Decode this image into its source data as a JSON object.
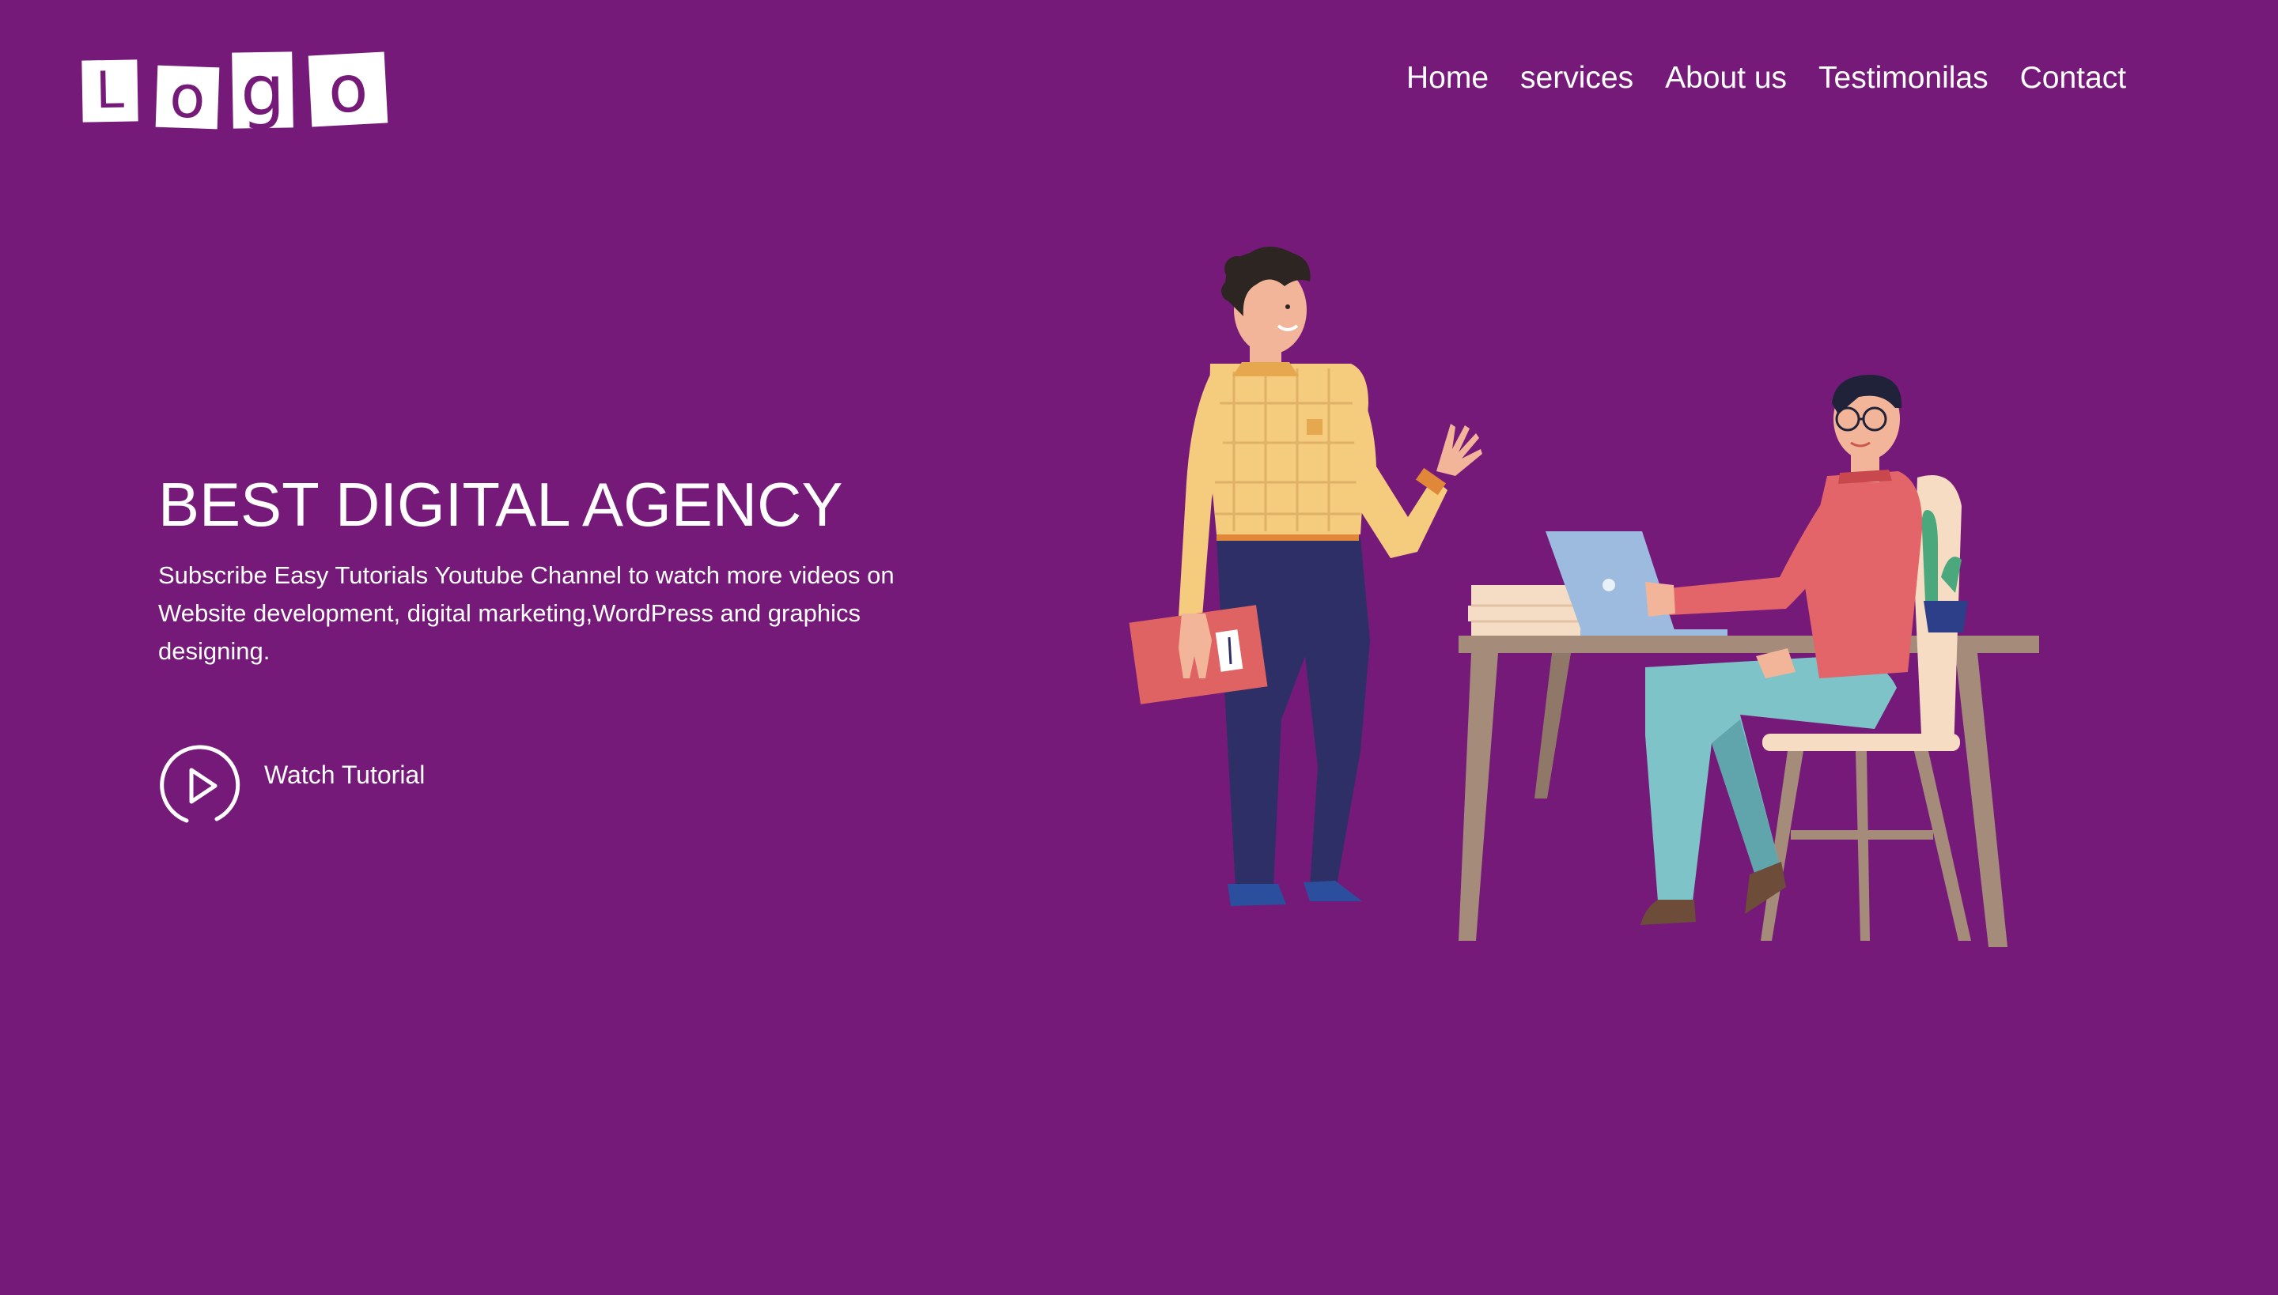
{
  "brand": {
    "logo_letters": [
      "L",
      "o",
      "g",
      "o"
    ]
  },
  "nav": {
    "items": [
      {
        "label": "Home"
      },
      {
        "label": "services"
      },
      {
        "label": "About us"
      },
      {
        "label": "Testimonilas"
      },
      {
        "label": "Contact"
      }
    ]
  },
  "hero": {
    "title": "BEST DIGITAL AGENCY",
    "description": "Subscribe Easy Tutorials Youtube Channel to watch more videos on Website development, digital marketing,WordPress and graphics designing.",
    "cta_label": "Watch Tutorial",
    "cta_icon": "play-circle-icon"
  },
  "illustration": {
    "subject": "office-scene-illustration"
  },
  "colors": {
    "background": "#751a79",
    "text": "#ffffff"
  }
}
